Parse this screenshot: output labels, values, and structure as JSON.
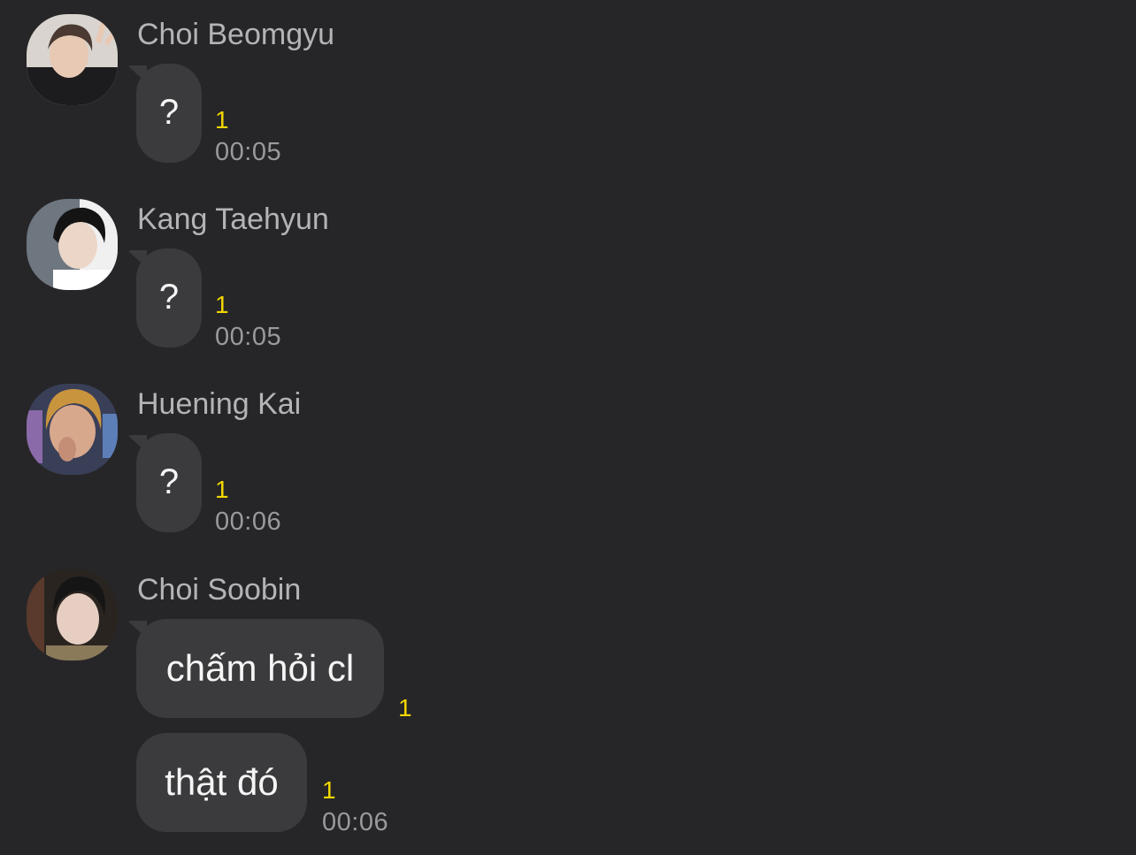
{
  "messages": [
    {
      "sender": "Choi Beomgyu",
      "avatar": "avatar-photo",
      "bubbles": [
        {
          "text": "?",
          "unread": "1"
        }
      ],
      "time": "00:05"
    },
    {
      "sender": "Kang Taehyun",
      "avatar": "avatar-photo",
      "bubbles": [
        {
          "text": "?",
          "unread": "1"
        }
      ],
      "time": "00:05"
    },
    {
      "sender": "Huening Kai",
      "avatar": "avatar-photo",
      "bubbles": [
        {
          "text": "?",
          "unread": "1"
        }
      ],
      "time": "00:06"
    },
    {
      "sender": "Choi Soobin",
      "avatar": "avatar-photo",
      "bubbles": [
        {
          "text": "chấm hỏi cl",
          "unread": "1"
        },
        {
          "text": "thật đó",
          "unread": "1"
        }
      ],
      "time": "00:06"
    }
  ],
  "colors": {
    "background": "#262628",
    "bubble": "#3b3b3d",
    "unread": "#f2d600",
    "sender_name": "#b4b4b6",
    "timestamp": "#9a9a9c"
  }
}
